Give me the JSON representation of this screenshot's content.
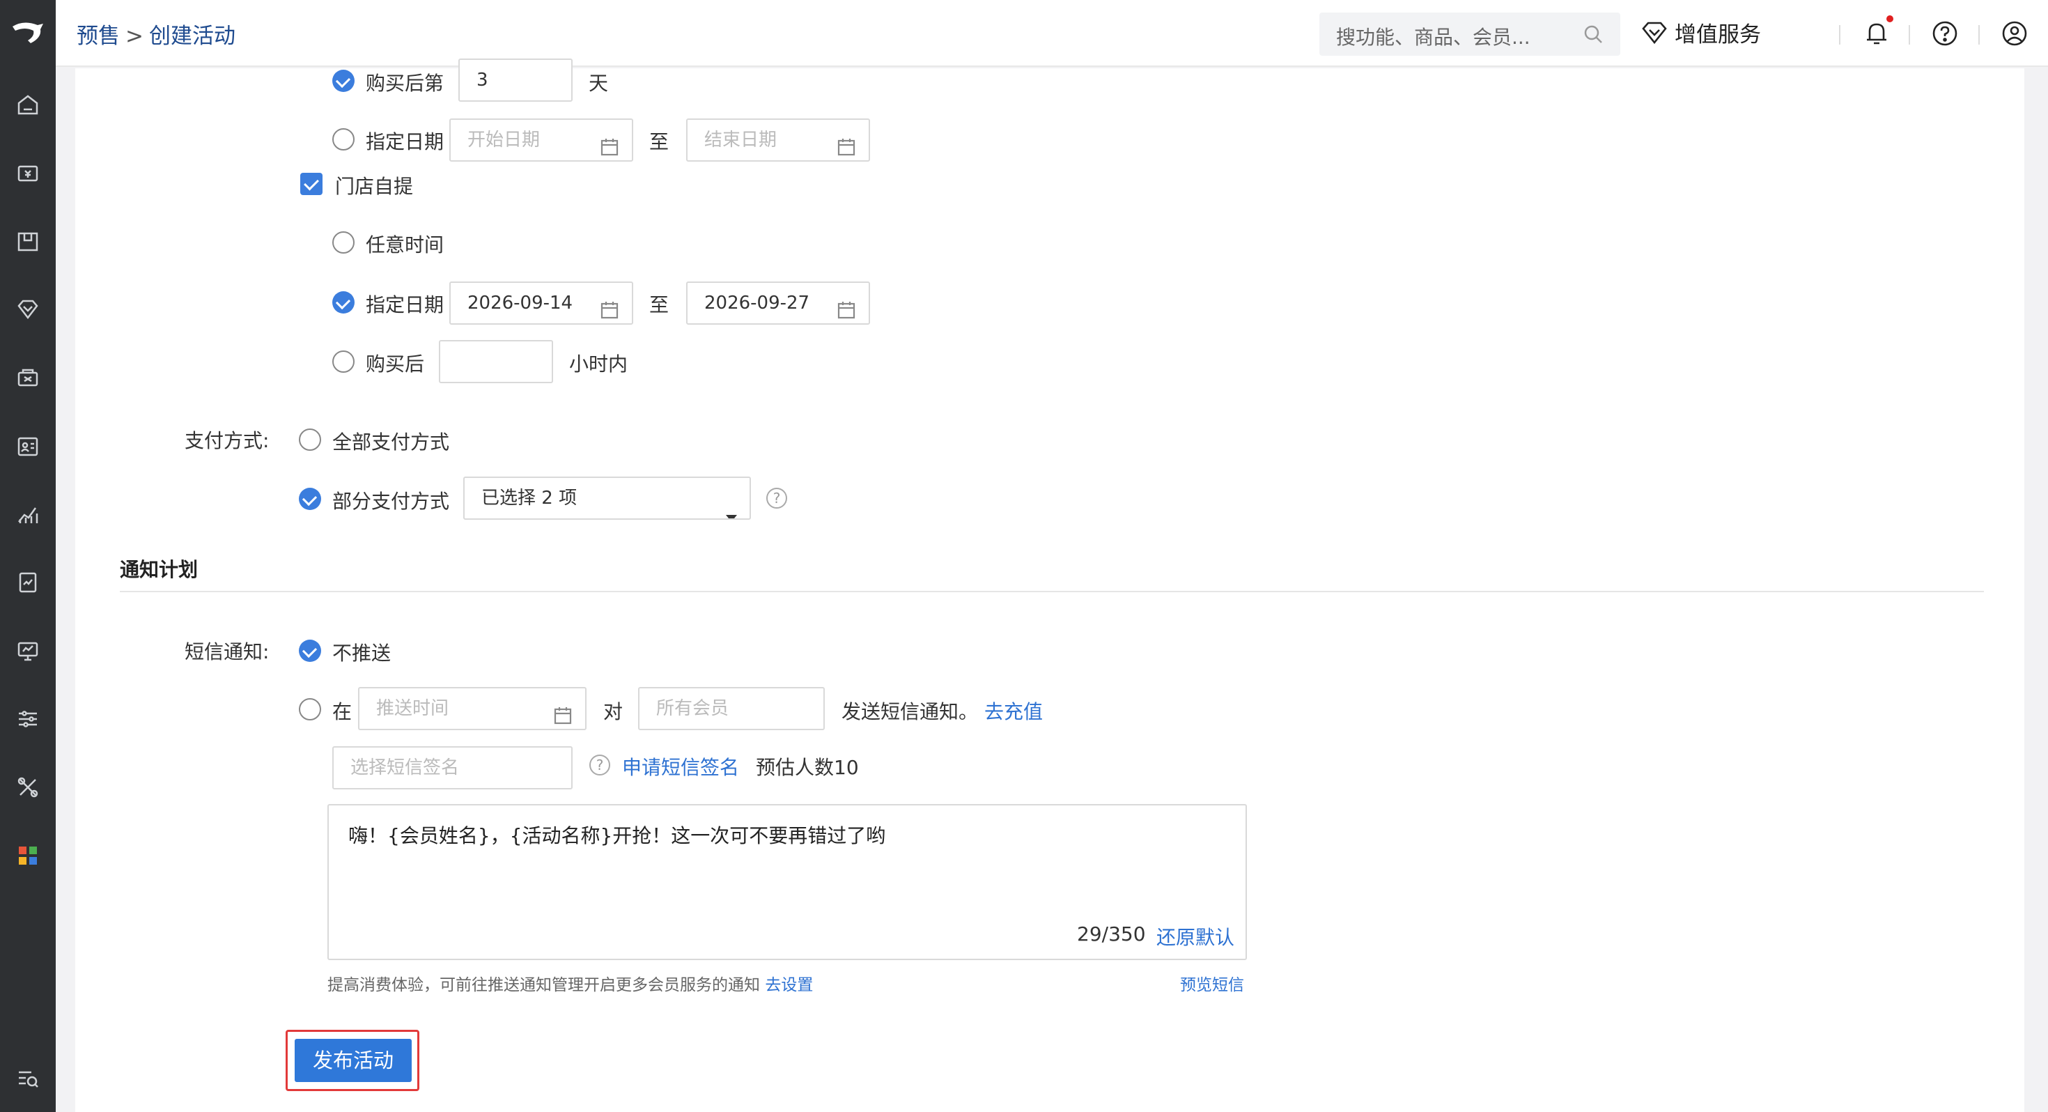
{
  "header": {
    "breadcrumb_parent": "预售",
    "breadcrumb_sep": ">",
    "breadcrumb_current": "创建活动",
    "search_placeholder": "搜功能、商品、会员...",
    "value_added_label": "增值服务"
  },
  "delivery": {
    "after_purchase_label": "购买后第",
    "after_purchase_value": "3",
    "after_purchase_unit": "天",
    "specify_date_label": "指定日期",
    "start_placeholder": "开始日期",
    "to_label": "至",
    "end_placeholder": "结束日期"
  },
  "pickup": {
    "checkbox_label": "门店自提",
    "any_time_label": "任意时间",
    "specify_date_label": "指定日期",
    "start_date": "2026-09-14",
    "to_label": "至",
    "end_date": "2026-09-27",
    "after_purchase_label": "购买后",
    "hours_unit": "小时内"
  },
  "payment": {
    "label": "支付方式:",
    "all_label": "全部支付方式",
    "partial_label": "部分支付方式",
    "selected_value": "已选择 2 项"
  },
  "notify": {
    "section_title": "通知计划",
    "sms_label": "短信通知:",
    "no_push_label": "不推送",
    "at_label": "在",
    "push_time_placeholder": "推送时间",
    "to_label": "对",
    "members_placeholder": "所有会员",
    "send_text": "发送短信通知。",
    "recharge_link": "去充值",
    "signature_placeholder": "选择短信签名",
    "apply_signature_link": "申请短信签名",
    "estimate_text": "预估人数10",
    "message": "嗨！{会员姓名}，{活动名称}开抢！这一次可不要再错过了哟",
    "char_count": "29/350",
    "restore_default": "还原默认",
    "tip_text": "提高消费体验，可前往推送通知管理开启更多会员服务的通知",
    "tip_link": "去设置",
    "preview_link": "预览短信"
  },
  "actions": {
    "publish_label": "发布活动"
  },
  "colors": {
    "accent": "#3b7ddd",
    "sidebar_bg": "#2e3033",
    "highlight_border": "#e23a3a"
  }
}
